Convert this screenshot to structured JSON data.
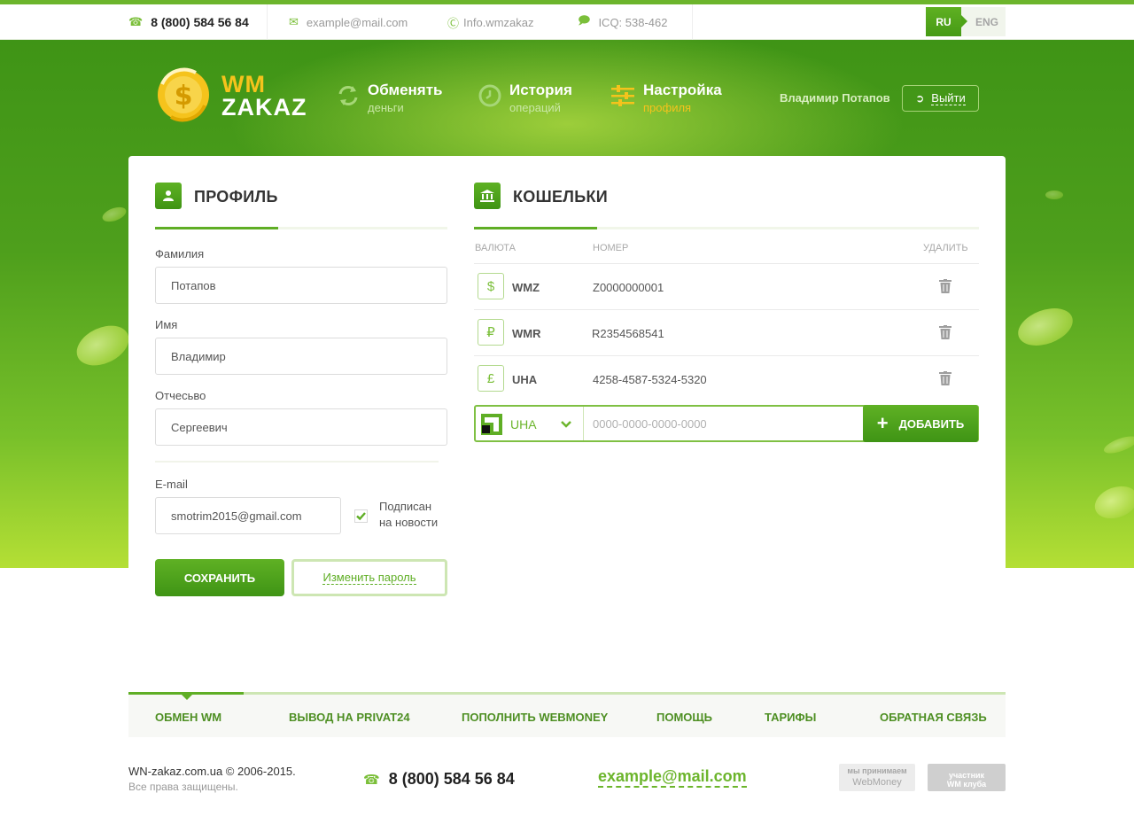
{
  "topbar": {
    "phone": "8 (800) 584 56 84",
    "email": "example@mail.com",
    "skype": "Info.wmzakaz",
    "icq": "ICQ: 538-462",
    "lang_ru": "RU",
    "lang_eng": "ENG"
  },
  "logo": {
    "line1": "WM",
    "line2": "ZAKAZ"
  },
  "nav": [
    {
      "title": "Обменять",
      "sub": "деньги",
      "icon": "exchange-icon"
    },
    {
      "title": "История",
      "sub": "операций",
      "icon": "clock-icon"
    },
    {
      "title": "Настройка",
      "sub": "профиля",
      "icon": "settings-sliders-icon"
    }
  ],
  "user": {
    "name": "Владимир Потапов",
    "logout": "Выйти"
  },
  "profile": {
    "title": "ПРОФИЛЬ",
    "surname_label": "Фамилия",
    "surname_value": "Потапов",
    "name_label": "Имя",
    "name_value": "Владимир",
    "patronymic_label": "Отчесьво",
    "patronymic_value": "Сергеевич",
    "email_label": "E-mail",
    "email_value": "smotrim2015@gmail.com",
    "subscribe_line1": "Подписан",
    "subscribe_line2": "на новости",
    "subscribed": true,
    "save_label": "СОХРАНИТЬ",
    "change_password_label": "Изменить пароль"
  },
  "wallets": {
    "title": "КОШЕЛЬКИ",
    "col_currency": "ВАЛЮТА",
    "col_number": "НОМЕР",
    "col_delete": "УДАЛИТЬ",
    "rows": [
      {
        "symbol": "$",
        "currency": "WMZ",
        "number": "Z0000000001"
      },
      {
        "symbol": "₽",
        "currency": "WMR",
        "number": "R2354568541"
      },
      {
        "symbol": "£",
        "currency": "UHA",
        "number": "4258-4587-5324-5320"
      }
    ],
    "add_currency": "UHA",
    "add_placeholder": "0000-0000-0000-0000",
    "add_label": "ДОБАВИТЬ"
  },
  "footer_nav": [
    "ОБМЕН WM",
    "ВЫВОД НА PRIVAT24",
    "ПОПОЛНИТЬ WEBMONEY",
    "ПОМОЩЬ",
    "ТАРИФЫ",
    "ОБРАТНАЯ СВЯЗЬ"
  ],
  "footer": {
    "copyright": "WN-zakaz.com.ua © 2006-2015.",
    "rights": "Все права защищены.",
    "phone": "8 (800) 584 56 84",
    "email": "example@mail.com",
    "badge1_line1": "мы принимаем",
    "badge1_line2": "WebMoney",
    "badge2_line1": "участник",
    "badge2_line2": "WM клуба"
  },
  "colors": {
    "accent": "#5fae25",
    "brand_yellow": "#f5c31c",
    "hero_dark": "#3f9416",
    "hero_light": "#b4df35"
  }
}
